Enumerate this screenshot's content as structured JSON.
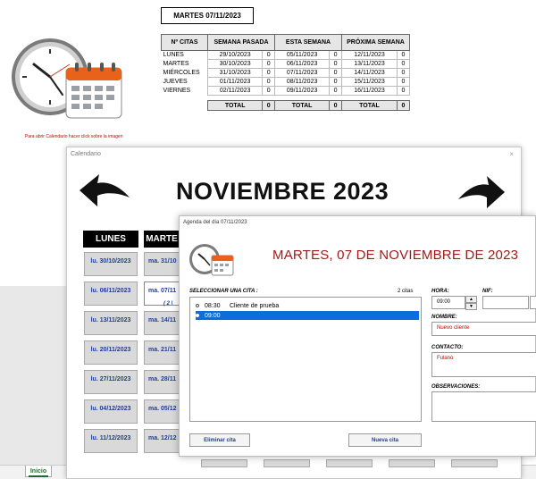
{
  "sheet": {
    "date_title": "MARTES 07/11/2023",
    "hint": "Para abrir Calendario hacer click sobre la imagen",
    "tab": "Inicio",
    "headers": [
      "Nº CITAS",
      "SEMANA PASADA",
      "",
      "ESTA SEMANA",
      "",
      "PRÓXIMA SEMANA",
      ""
    ],
    "rows": [
      {
        "day": "LUNES",
        "past": "29/10/2023",
        "past_n": "0",
        "this": "05/11/2023",
        "this_n": "0",
        "next": "12/11/2023",
        "next_n": "0"
      },
      {
        "day": "MARTES",
        "past": "30/10/2023",
        "past_n": "0",
        "this": "06/11/2023",
        "this_n": "0",
        "next": "13/11/2023",
        "next_n": "0"
      },
      {
        "day": "MIÉRCOLES",
        "past": "31/10/2023",
        "past_n": "0",
        "this": "07/11/2023",
        "this_n": "0",
        "next": "14/11/2023",
        "next_n": "0"
      },
      {
        "day": "JUEVES",
        "past": "01/11/2023",
        "past_n": "0",
        "this": "08/11/2023",
        "this_n": "0",
        "next": "15/11/2023",
        "next_n": "0"
      },
      {
        "day": "VIERNES",
        "past": "02/11/2023",
        "past_n": "0",
        "this": "09/11/2023",
        "this_n": "0",
        "next": "16/11/2023",
        "next_n": "0"
      }
    ],
    "total_label": "TOTAL",
    "totals": [
      "0",
      "0",
      "0"
    ]
  },
  "calendar": {
    "window_title": "Calendario",
    "close": "×",
    "month": "NOVIEMBRE 2023",
    "col_lunes": "LUNES",
    "col_martes": "MARTE",
    "lunes": [
      "lu. 30/10/2023",
      "lu. 06/11/2023",
      "lu. 13/11/2023",
      "lu. 20/11/2023",
      "lu. 27/11/2023",
      "lu. 04/12/2023",
      "lu. 11/12/2023"
    ],
    "martes": [
      "ma. 31/10",
      "ma. 07/11",
      "ma. 14/11",
      "ma. 21/11",
      "ma. 28/11",
      "ma. 05/12",
      "ma. 12/12"
    ],
    "martes_sub": "( 2 \\"
  },
  "agenda": {
    "title": "Agenda del día 07/11/2023",
    "heading": "MARTES, 07 DE NOVIEMBRE DE 2023",
    "select_label": "SELECCIONAR UNA CITA :",
    "count": "2 citas",
    "items": [
      {
        "time": "08:30",
        "client": "Cliente de prueba"
      },
      {
        "time": "09:00",
        "client": ""
      }
    ],
    "delete_button": "Eliminar cita",
    "new_button": "Nueva cita",
    "hora_label": "HORA:",
    "hora_value": "09:00",
    "nif_label": "NIF:",
    "nombre_label": "NOMBRE:",
    "nombre_value": "Nuevo cliente",
    "contacto_label": "CONTACTO:",
    "contacto_value": "Fulano",
    "observaciones_label": "OBSERVACIONES:"
  },
  "colors": {
    "accent_red": "#a11a1a",
    "selection_blue": "#0a6fdb",
    "link_blue": "#1f3d99",
    "sheet_green": "#1d6b2c"
  }
}
